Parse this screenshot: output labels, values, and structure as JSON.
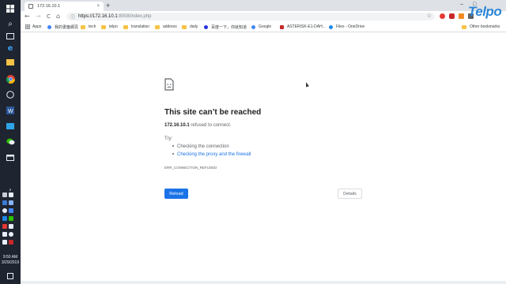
{
  "taskbar": {
    "icons": [
      "start-icon",
      "search-icon",
      "task-view-icon",
      "edge-icon",
      "file-explorer-icon",
      "chrome-icon",
      "clock-app-icon",
      "word-icon",
      "outlook-icon",
      "wechat-icon",
      "window-icon"
    ],
    "time": "9:50 AM",
    "date": "3/29/2019"
  },
  "browser": {
    "tab_title": "172.16.10.1",
    "tab_close": "×",
    "new_tab": "+",
    "window_minimize": "–",
    "window_maximize": "□",
    "window_close": "×",
    "nav_back": "←",
    "nav_forward": "→",
    "nav_reload": "C",
    "nav_home": "⌂",
    "info_icon": "ⓘ",
    "url_host": "https://172.16.10.1",
    "url_rest": ":8008/index.php",
    "bookmark_star": "☆",
    "logo_text": "Telpo"
  },
  "bookmarks": {
    "apps": "Apps",
    "items": [
      "我的書籤網頁",
      "tech",
      "telpo",
      "translation",
      "address",
      "daily",
      "百度一下，你就知道",
      "Google",
      "ASTERISK-E1-DAH...",
      "Files - OneDrive"
    ],
    "other": "Other bookmarks"
  },
  "error_page": {
    "title": "This site can’t be reached",
    "host": "172.16.10.1",
    "message": " refused to connect.",
    "try_label": "Try:",
    "suggestion_1": "Checking the connection",
    "suggestion_2": "Checking the proxy and the firewall",
    "error_code": "ERR_CONNECTION_REFUSED",
    "reload_label": "Reload",
    "details_label": "Details"
  },
  "colors": {
    "accent": "#1a73e8",
    "link": "#1a73e8",
    "taskbar": "#1e2430"
  }
}
